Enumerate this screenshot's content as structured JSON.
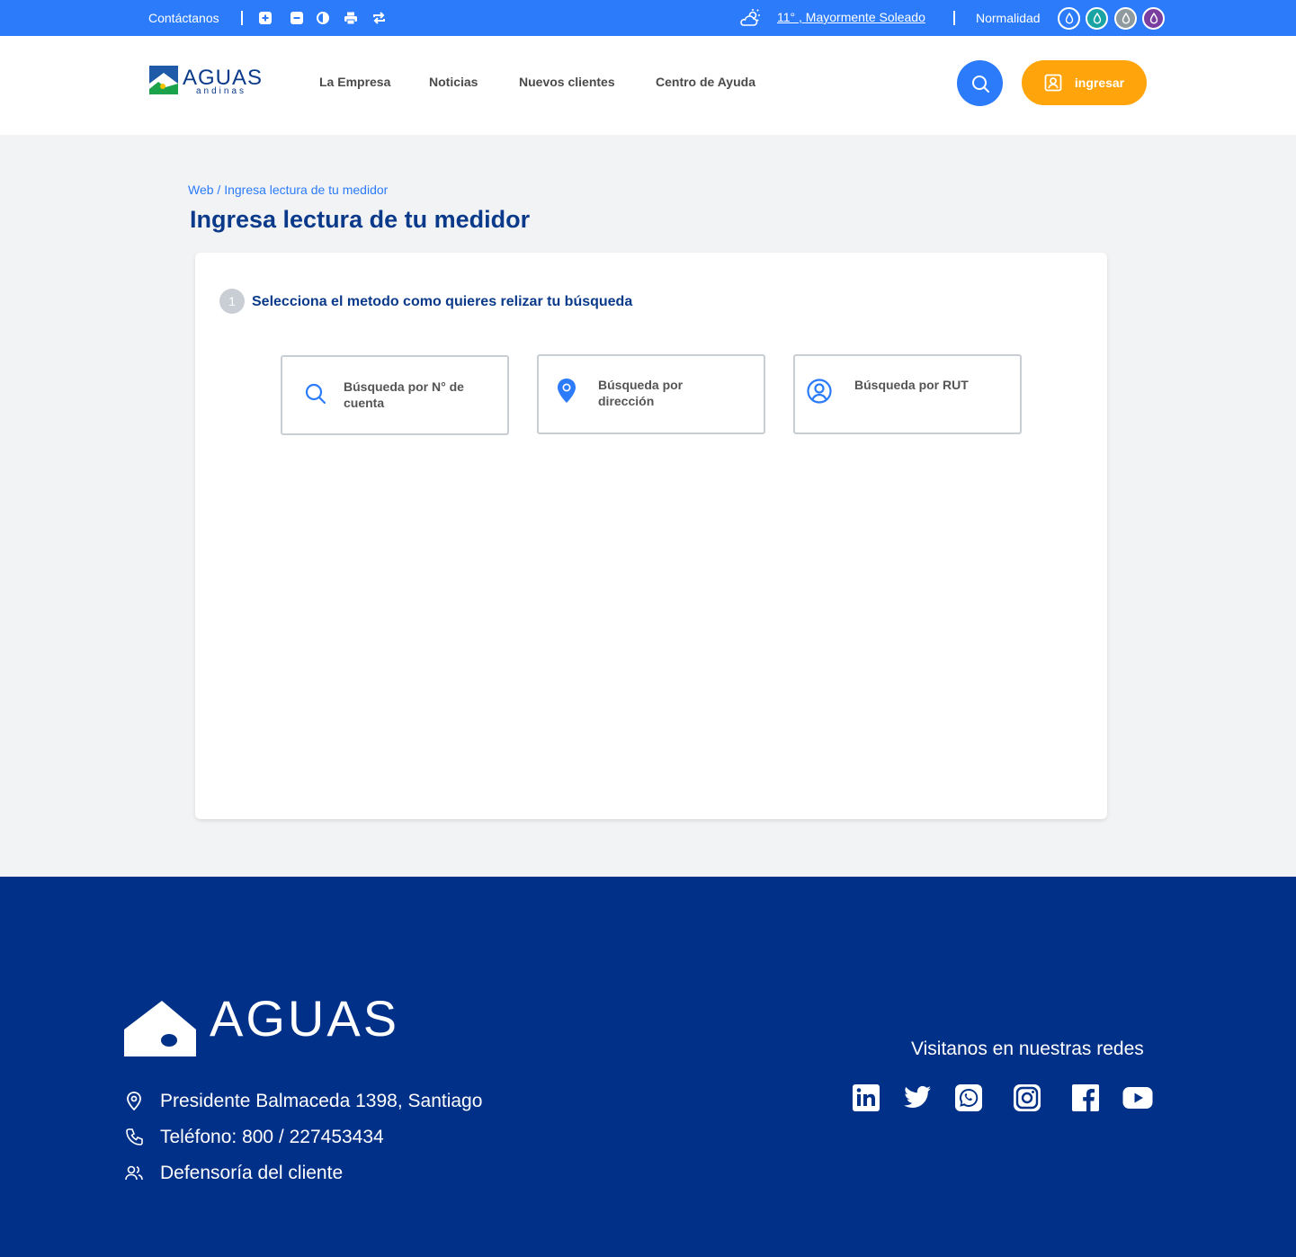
{
  "topbar": {
    "contact_label": "Contáctanos",
    "tools": [
      "zoom-in-icon",
      "zoom-out-icon",
      "contrast-icon",
      "print-icon",
      "refresh-icon"
    ],
    "weather": "11° , Mayormente Soleado",
    "status": "Normalidad",
    "drop_colors": [
      "#2b7bfa",
      "#1aa3a3",
      "#8f9a9e",
      "#7a3ea0"
    ]
  },
  "header": {
    "logo_main": "AGUAS",
    "logo_sub": "andinas",
    "nav": [
      "La Empresa",
      "Noticias",
      "Nuevos clientes",
      "Centro de Ayuda"
    ],
    "login_label": "ingresar"
  },
  "main": {
    "breadcrumb": "Web / Ingresa lectura de tu medidor",
    "title": "Ingresa lectura de tu medidor",
    "step_number": "1",
    "step_title": "Selecciona el metodo como quieres relizar tu búsqueda",
    "options": [
      {
        "label": "Búsqueda por N° de cuenta",
        "icon": "search-icon"
      },
      {
        "label": "Búsqueda por dirección",
        "icon": "location-pin-icon"
      },
      {
        "label": "Búsqueda por RUT",
        "icon": "user-circle-icon"
      }
    ]
  },
  "footer": {
    "logo_text": "AGUAS",
    "address": "Presidente Balmaceda 1398, Santiago",
    "phone": "Teléfono: 800 / 227453434",
    "defense": "Defensoría del cliente",
    "social_title": "Visitanos en nuestras redes",
    "social": [
      "linkedin-icon",
      "twitter-icon",
      "whatsapp-icon",
      "instagram-icon",
      "facebook-icon",
      "youtube-icon"
    ]
  },
  "colors": {
    "primary": "#2b7bfa",
    "navy": "#003087",
    "title": "#0b3a8a",
    "accent": "#ffa40a"
  }
}
